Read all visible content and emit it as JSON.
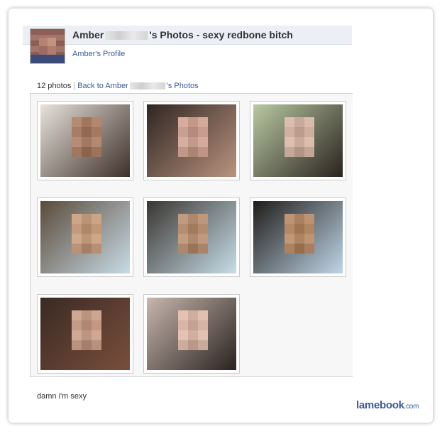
{
  "page": {
    "title_prefix": "Amber",
    "title_suffix": "'s Photos - sexy redbone bitch",
    "profile_link": "Amber's Profile",
    "photo_count": "12 photos",
    "back_link_prefix": "Back to Amber",
    "back_link_suffix": "'s Photos",
    "caption": "damn i'm sexy",
    "watermark_main": "lamebook",
    "watermark_suffix": ".com"
  },
  "photos": [
    {
      "bg1": "#e7e3dc",
      "bg2": "#3e2f29",
      "face": "#a9785e"
    },
    {
      "bg1": "#2f2622",
      "bg2": "#b9937f",
      "face": "#cf9f8f"
    },
    {
      "bg1": "#b8c9a2",
      "bg2": "#2a221f",
      "face": "#d7b3a1"
    },
    {
      "bg1": "#5a4a3a",
      "bg2": "#c8dbe6",
      "face": "#c79a78"
    },
    {
      "bg1": "#3a3631",
      "bg2": "#c7dde8",
      "face": "#b88c6c"
    },
    {
      "bg1": "#1f1c19",
      "bg2": "#bfd6e8",
      "face": "#b5855f"
    },
    {
      "bg1": "#3a2a24",
      "bg2": "#7a4e3c",
      "face": "#c89a82"
    },
    {
      "bg1": "#c7b7ad",
      "bg2": "#2a2220",
      "face": "#e0b8a6"
    }
  ]
}
